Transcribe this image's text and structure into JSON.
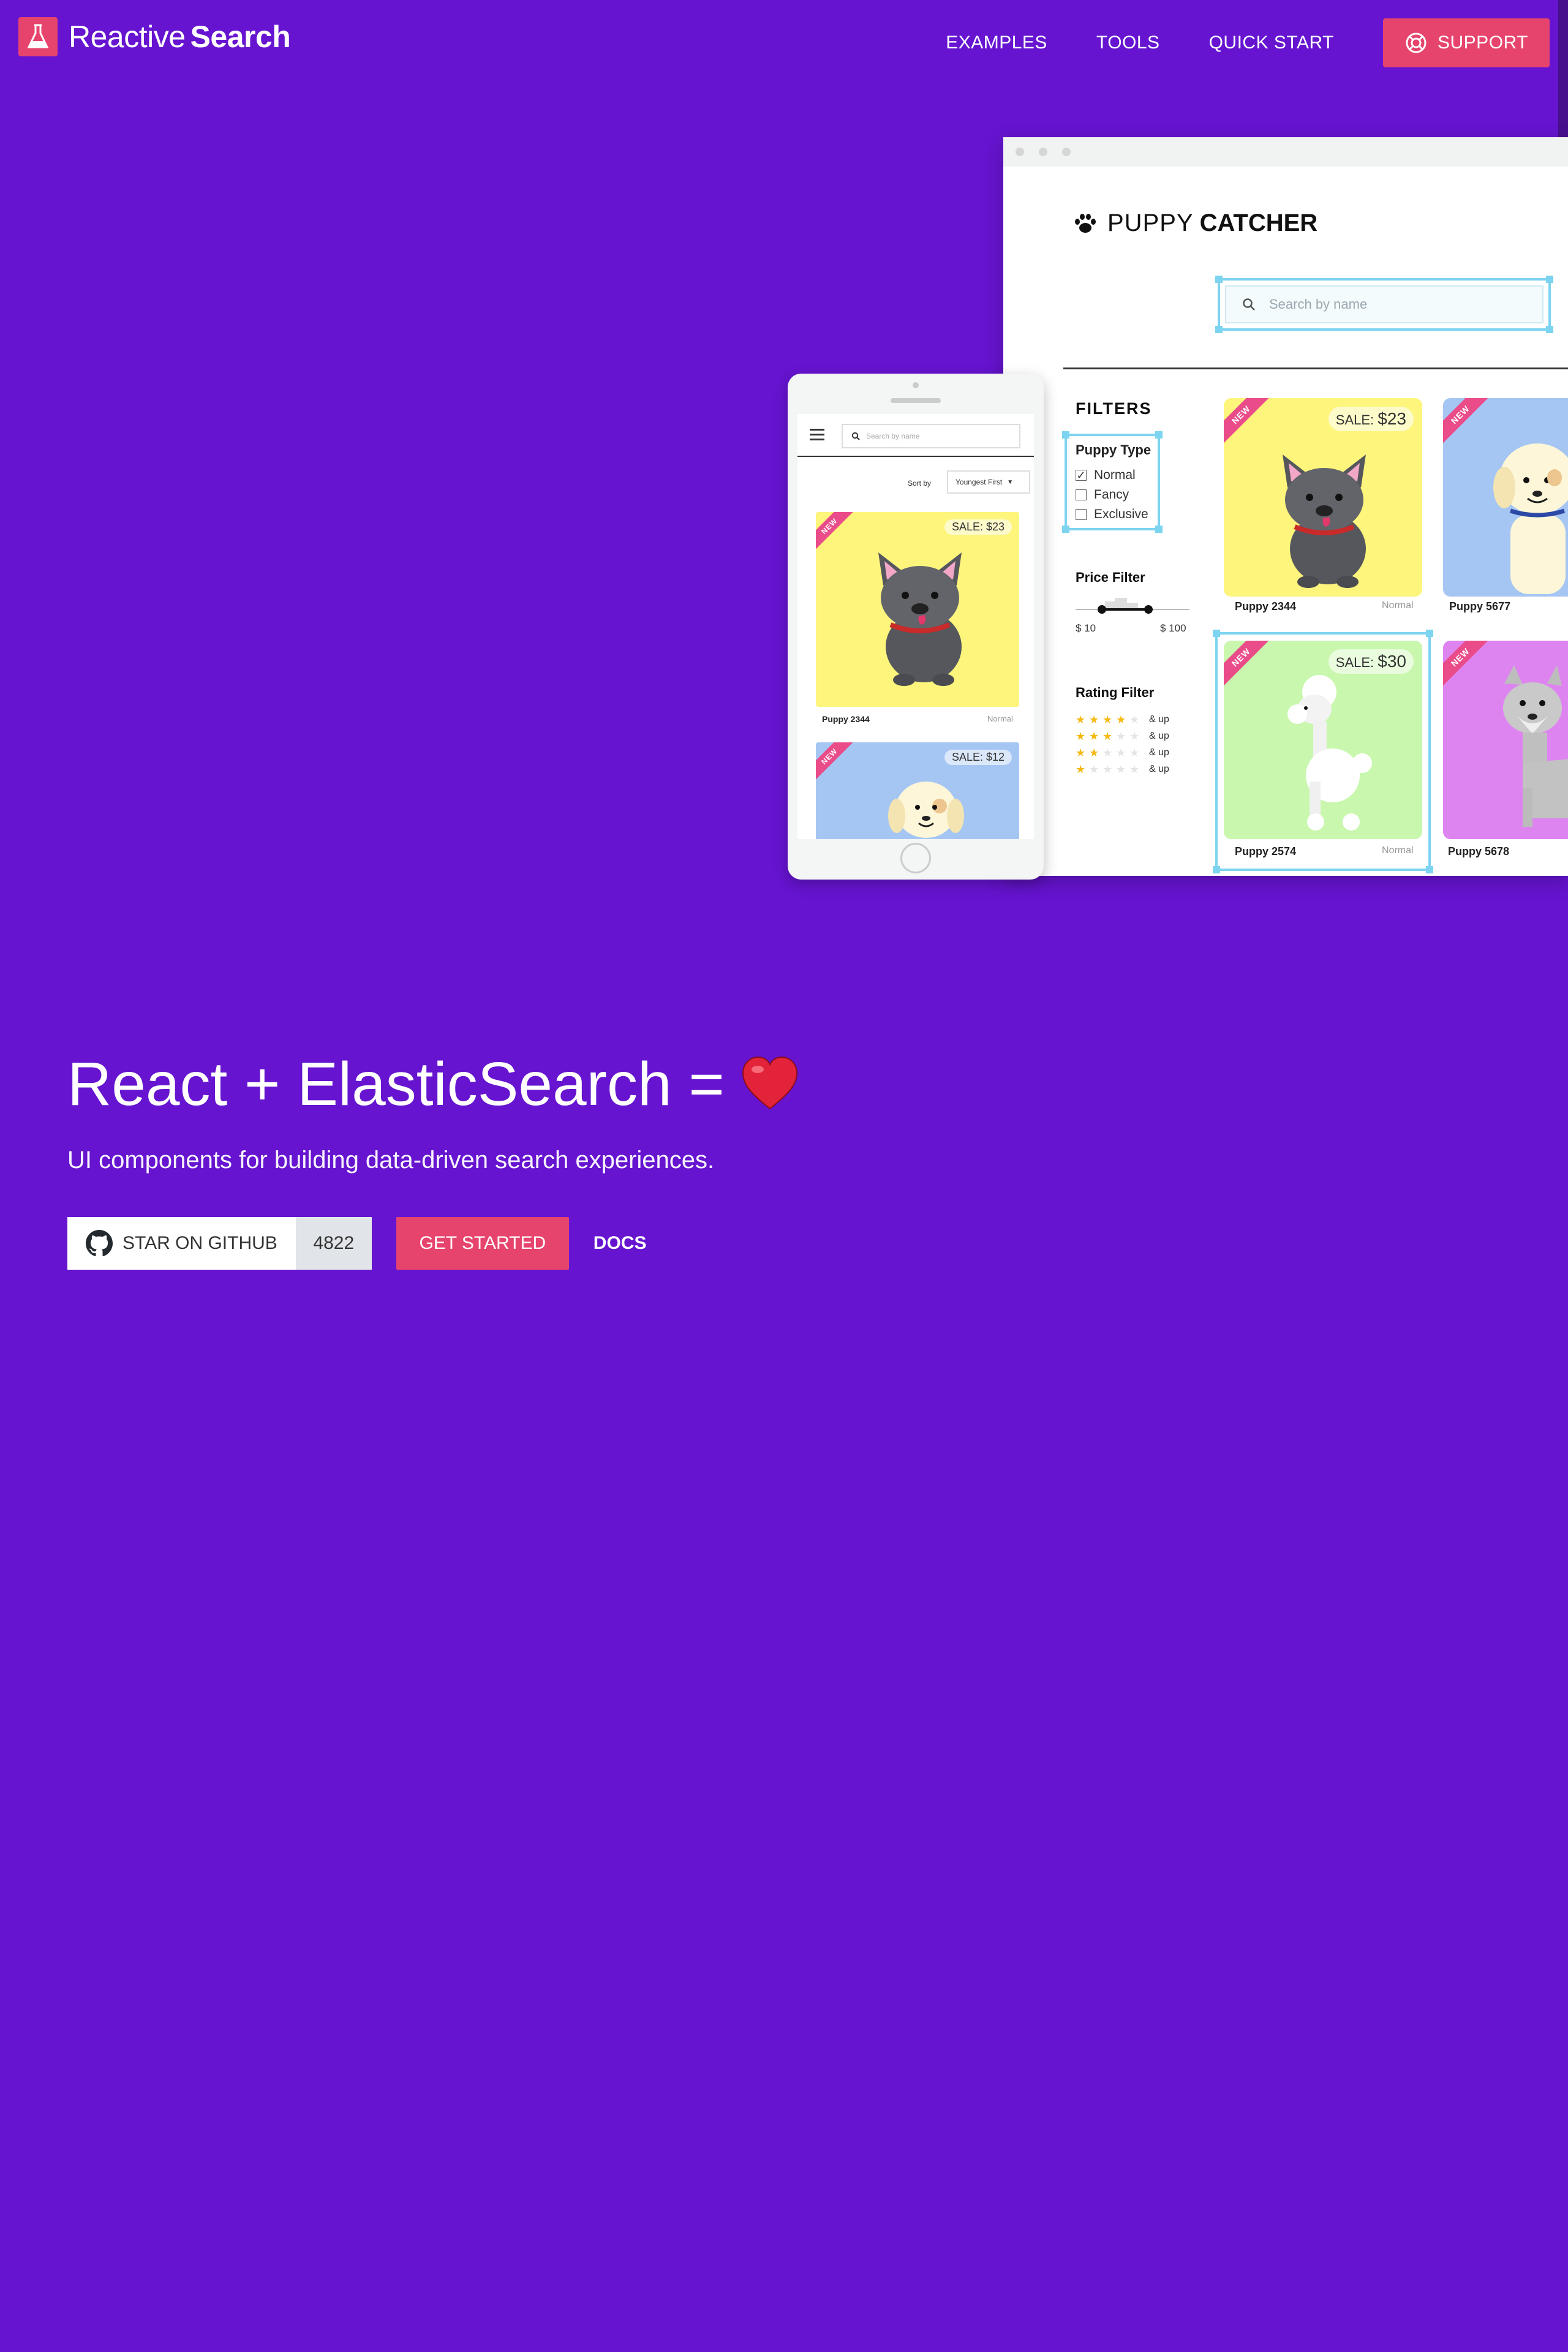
{
  "brand": {
    "light": "Reactive",
    "bold": "Search"
  },
  "nav": {
    "examples": "EXAMPLES",
    "tools": "TOOLS",
    "quick_start": "QUICK START",
    "support": "SUPPORT"
  },
  "hero": {
    "title": "React + ElasticSearch =",
    "subtitle": "UI components for building data-driven search experiences.",
    "github_label": "STAR ON GITHUB",
    "github_stars": "4822",
    "get_started": "GET STARTED",
    "docs": "DOCS"
  },
  "desktop_demo": {
    "brand_light": "PUPPY",
    "brand_bold": "CATCHER",
    "search_placeholder": "Search by name",
    "filters_title": "FILTERS",
    "puppy_type": {
      "title": "Puppy Type",
      "options": [
        {
          "label": "Normal",
          "checked": true
        },
        {
          "label": "Fancy",
          "checked": false
        },
        {
          "label": "Exclusive",
          "checked": false
        }
      ]
    },
    "price_filter": {
      "title": "Price Filter",
      "min": "$ 10",
      "max": "$ 100"
    },
    "rating_filter": {
      "title": "Rating Filter",
      "suffix": "& up",
      "levels": [
        4,
        3,
        2,
        1
      ]
    },
    "cards": [
      {
        "name": "Puppy 2344",
        "type": "Normal",
        "badge": "NEW",
        "sale_label": "SALE:",
        "sale_amount": "$23",
        "bg": "#fdf57c"
      },
      {
        "name": "Puppy 5677",
        "badge": "NEW",
        "bg": "#a5c6f3"
      },
      {
        "name": "Puppy 2574",
        "type": "Normal",
        "badge": "NEW",
        "sale_label": "SALE:",
        "sale_amount": "$30",
        "bg": "#c8f7ad"
      },
      {
        "name": "Puppy 5678",
        "badge": "NEW",
        "bg": "#de84f0"
      }
    ]
  },
  "mobile_demo": {
    "search_placeholder": "Search by name",
    "sort_label": "Sort by",
    "sort_value": "Youngest First",
    "cards": [
      {
        "name": "Puppy 2344",
        "type": "Normal",
        "badge": "NEW",
        "sale": "SALE: $23",
        "bg": "#fdf57c"
      },
      {
        "badge": "NEW",
        "sale": "SALE: $12",
        "bg": "#a5c6f3"
      }
    ]
  },
  "colors": {
    "background": "#6614d0",
    "accent": "#e6446d",
    "selection": "#7dd4f0"
  }
}
